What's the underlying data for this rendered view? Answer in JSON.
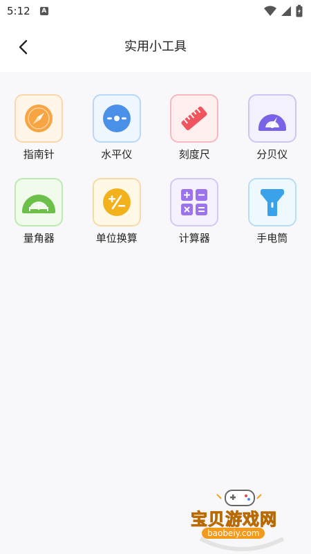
{
  "status": {
    "time": "5:12",
    "notif_letter": "A"
  },
  "header": {
    "title": "实用小工具",
    "back_icon": "back-arrow-icon"
  },
  "tools": [
    {
      "label": "指南针",
      "icon": "compass-icon",
      "border": "#f8d7a9",
      "bg": "#fff5e8",
      "accent": "#f7a443"
    },
    {
      "label": "水平仪",
      "icon": "level-icon",
      "border": "#b9d7f7",
      "bg": "#eef6ff",
      "accent": "#4a90e8"
    },
    {
      "label": "刻度尺",
      "icon": "ruler-icon",
      "border": "#f6b8be",
      "bg": "#ffefef",
      "accent": "#f0555f"
    },
    {
      "label": "分贝仪",
      "icon": "decibel-meter-icon",
      "border": "#cfc4f2",
      "bg": "#f4f1ff",
      "accent": "#7a62e6"
    },
    {
      "label": "量角器",
      "icon": "protractor-icon",
      "border": "#bde8b0",
      "bg": "#f0fbec",
      "accent": "#6cc04a"
    },
    {
      "label": "单位换算",
      "icon": "unit-conversion-icon",
      "border": "#f6dca3",
      "bg": "#fff8e6",
      "accent": "#f2b21e"
    },
    {
      "label": "计算器",
      "icon": "calculator-icon",
      "border": "#d6c7f3",
      "bg": "#f6f1ff",
      "accent": "#9b73ea"
    },
    {
      "label": "手电筒",
      "icon": "flashlight-icon",
      "border": "#b7ddf5",
      "bg": "#eef8ff",
      "accent": "#3aa2e8"
    }
  ],
  "watermark": {
    "brand": "宝贝游戏网",
    "url": "baobeiy.com"
  }
}
